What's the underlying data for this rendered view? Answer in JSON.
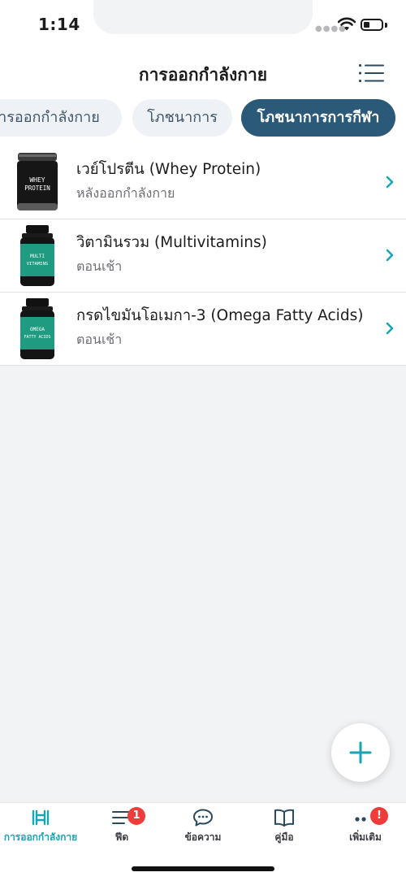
{
  "status_bar": {
    "time": "1:14",
    "icons": [
      "signal-dots-icon",
      "wifi-icon",
      "battery-icon"
    ]
  },
  "header": {
    "title": "การออกกำลังกาย",
    "menu_icon": "list-menu-icon"
  },
  "tabs": [
    {
      "label": "การออกกำลังกาย",
      "selected": false
    },
    {
      "label": "โภชนาการ",
      "selected": false
    },
    {
      "label": "โภชนาการการกีฬา",
      "selected": true
    }
  ],
  "supplements": [
    {
      "name": "เวย์โปรตีน (Whey Protein)",
      "timing": "หลังออกกำลังกาย",
      "label_lines": [
        "WHEY",
        "PROTEIN"
      ]
    },
    {
      "name": "วิตามินรวม (Multivitamins)",
      "timing": "ตอนเช้า",
      "label_lines": [
        "MULTI",
        "VITAMINS"
      ]
    },
    {
      "name": "กรดไขมันโอเมกา-3 (Omega Fatty Acids)",
      "timing": "ตอนเช้า",
      "label_lines": [
        "OMEGA",
        "FATTY ACIDS"
      ]
    }
  ],
  "fab": {
    "icon": "plus-icon"
  },
  "tab_bar": [
    {
      "label": "การออกกำลังกาย",
      "icon": "dumbbell-icon",
      "active": true
    },
    {
      "label": "ฟีด",
      "icon": "feed-icon",
      "badge": "1"
    },
    {
      "label": "ข้อความ",
      "icon": "chat-bubble-icon"
    },
    {
      "label": "คู่มือ",
      "icon": "book-icon"
    },
    {
      "label": "เพิ่มเติม",
      "icon": "more-dots-icon",
      "badge": "!"
    }
  ],
  "colors": {
    "accent": "#17a6b2",
    "selected_tab": "#2b5a78",
    "badge": "#f03b3b",
    "bottle_teal": "#1e9b80"
  }
}
